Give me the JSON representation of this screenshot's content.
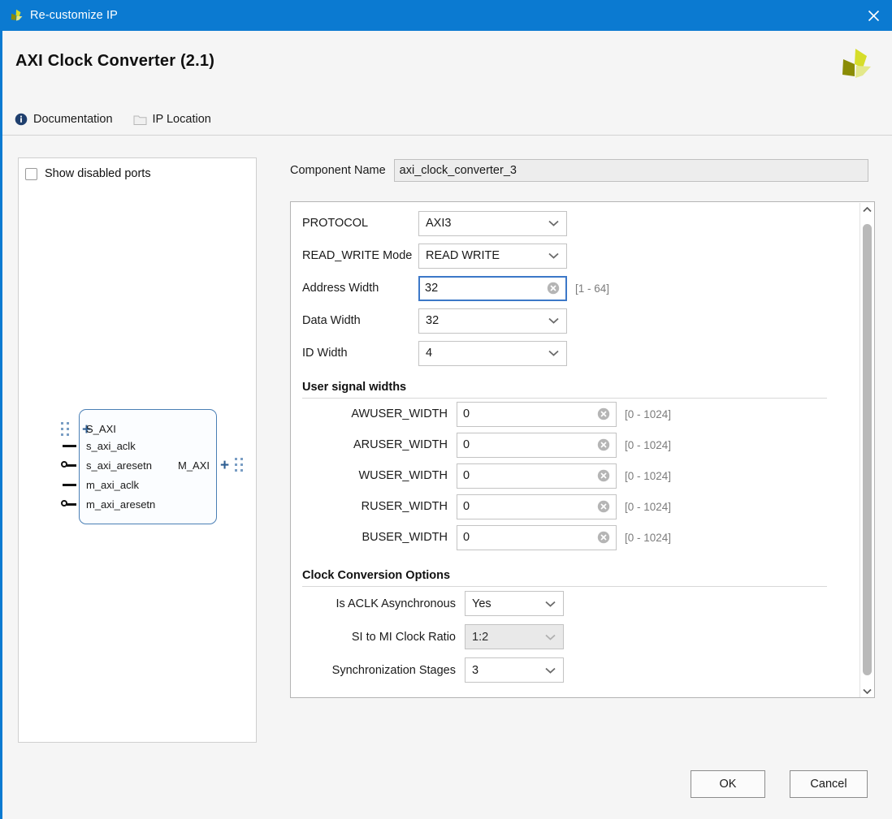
{
  "window": {
    "title": "Re-customize IP",
    "close_icon": "close-icon",
    "app_icon": "xilinx-logo-icon"
  },
  "header": {
    "page_title": "AXI Clock Converter (2.1)",
    "logo_icon": "xilinx-logo-icon"
  },
  "toolbar": {
    "documentation": {
      "label": "Documentation",
      "icon": "info-icon"
    },
    "ip_location": {
      "label": "IP Location",
      "icon": "folder-icon"
    }
  },
  "preview": {
    "show_disabled_ports": {
      "label": "Show disabled ports",
      "checked": false
    },
    "symbol": {
      "left_ports": [
        {
          "name": "S_AXI",
          "type": "bus"
        },
        {
          "name": "s_axi_aclk",
          "type": "clock"
        },
        {
          "name": "s_axi_aresetn",
          "type": "reset_low"
        },
        {
          "name": "m_axi_aclk",
          "type": "clock"
        },
        {
          "name": "m_axi_aresetn",
          "type": "reset_low"
        }
      ],
      "right_ports": [
        {
          "name": "M_AXI",
          "type": "bus"
        }
      ]
    }
  },
  "config": {
    "component_name": {
      "label": "Component Name",
      "value": "axi_clock_converter_3"
    },
    "fields": [
      {
        "label": "PROTOCOL",
        "value": "AXI3",
        "kind": "select",
        "disabled": false
      },
      {
        "label": "READ_WRITE Mode",
        "value": "READ WRITE",
        "kind": "select",
        "disabled": false
      },
      {
        "label": "Address Width",
        "value": "32",
        "kind": "text",
        "range": "[1 - 64]",
        "focused": true
      },
      {
        "label": "Data Width",
        "value": "32",
        "kind": "select",
        "disabled": false
      },
      {
        "label": "ID Width",
        "value": "4",
        "kind": "select",
        "disabled": false
      }
    ],
    "user_signal_widths": {
      "title": "User signal widths",
      "rows": [
        {
          "label": "AWUSER_WIDTH",
          "value": "0",
          "range": "[0 - 1024]"
        },
        {
          "label": "ARUSER_WIDTH",
          "value": "0",
          "range": "[0 - 1024]"
        },
        {
          "label": "WUSER_WIDTH",
          "value": "0",
          "range": "[0 - 1024]"
        },
        {
          "label": "RUSER_WIDTH",
          "value": "0",
          "range": "[0 - 1024]"
        },
        {
          "label": "BUSER_WIDTH",
          "value": "0",
          "range": "[0 - 1024]"
        }
      ]
    },
    "clock_conversion_options": {
      "title": "Clock Conversion Options",
      "rows": [
        {
          "label": "Is ACLK Asynchronous",
          "value": "Yes",
          "disabled": false
        },
        {
          "label": "SI to MI Clock Ratio",
          "value": "1:2",
          "disabled": true
        },
        {
          "label": "Synchronization Stages",
          "value": "3",
          "disabled": false
        }
      ]
    }
  },
  "footer": {
    "ok_label": "OK",
    "cancel_label": "Cancel"
  },
  "colors": {
    "titlebar": "#0b7ad1",
    "focus_border": "#3c78c8",
    "symbol_border": "#4a7fb5",
    "dialog_bg": "#f5f5f5"
  }
}
